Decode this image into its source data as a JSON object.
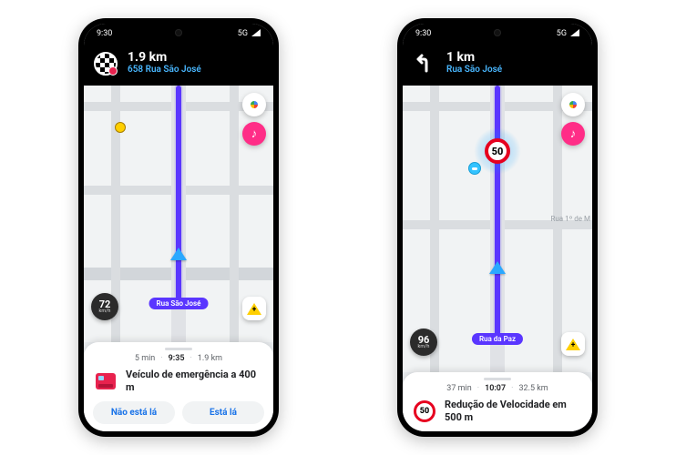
{
  "phones": [
    {
      "statusbar": {
        "time": "9:30",
        "network": "5G"
      },
      "nav": {
        "icon": "destination",
        "distance": "1.9 km",
        "street": "658 Rua São José"
      },
      "map": {
        "street_pill": "Rua São José",
        "speed": {
          "value": "72",
          "unit": "km/h"
        }
      },
      "card": {
        "eta_min": "5 min",
        "eta_time": "9:35",
        "eta_dist": "1.9 km",
        "alert_text": "Veículo de emergência a 400 m",
        "btn_no": "Não está lá",
        "btn_yes": "Está lá"
      }
    },
    {
      "statusbar": {
        "time": "9:30",
        "network": "5G"
      },
      "nav": {
        "icon": "turn-left",
        "distance": "1 km",
        "street": "Rua São José"
      },
      "map": {
        "street_pill": "Rua da Paz",
        "side_street": "Rua 1º de M",
        "speed_limit": "50",
        "speed": {
          "value": "96",
          "unit": "km/h"
        }
      },
      "card": {
        "eta_min": "37 min",
        "eta_time": "10:07",
        "eta_dist": "32.5 km",
        "alert_speed_limit": "50",
        "alert_text": "Redução de Velocidade em 500 m"
      }
    }
  ]
}
